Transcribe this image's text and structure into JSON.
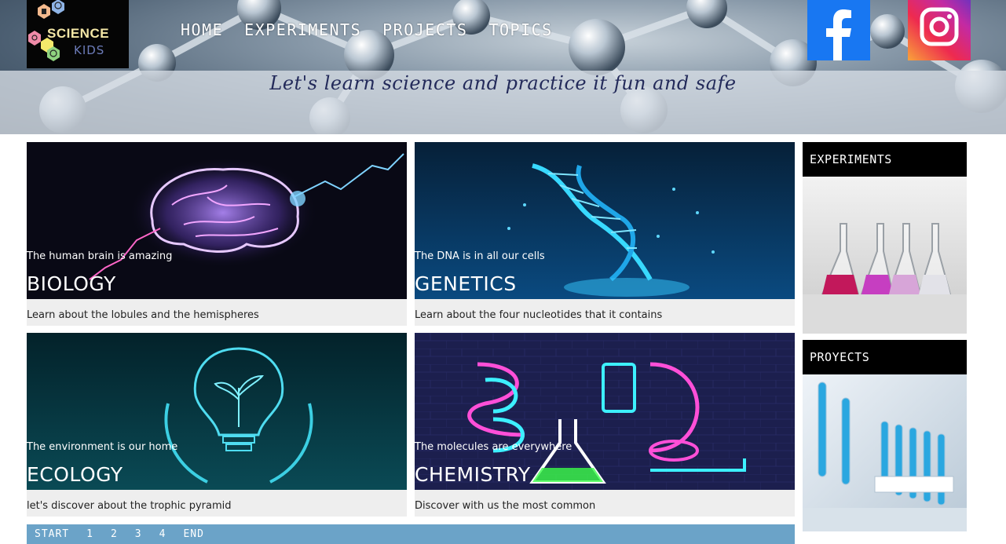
{
  "header": {
    "logo": {
      "word1": "SCIENCE",
      "word2": "KIDS"
    },
    "nav": [
      "HOME",
      "EXPERIMENTS",
      "PROJECTS",
      "TOPICS"
    ],
    "tagline": "Let's learn science and practice it fun and safe"
  },
  "cards": [
    {
      "caption": "The human brain is amazing",
      "title": "BIOLOGY",
      "description": "Learn about the lobules and the hemispheres"
    },
    {
      "caption": "The DNA is in all our cells",
      "title": "GENETICS",
      "description": "Learn about the four nucleotides that it contains"
    },
    {
      "caption": "The environment is our home",
      "title": "ECOLOGY",
      "description": "let's discover about the trophic pyramid"
    },
    {
      "caption": "The molecules are everywhere",
      "title": "CHEMISTRY",
      "description": "Discover with us the most common"
    }
  ],
  "sidebar": [
    {
      "title": "EXPERIMENTS"
    },
    {
      "title": "PROYECTS"
    }
  ],
  "pagination": [
    "START",
    "1",
    "2",
    "3",
    "4",
    "END"
  ],
  "colors": {
    "pager": "#6ba3c8",
    "facebook": "#1877f2",
    "card_bg": "#eeeeee"
  }
}
